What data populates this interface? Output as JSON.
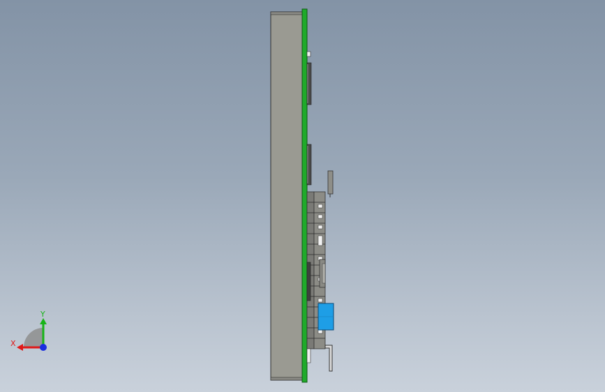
{
  "colors": {
    "background_top": "#8393a6",
    "background_bottom": "#c9d1db",
    "enclosure": "#9a9a92",
    "pcb": "#1faa2a",
    "component_dark": "#4a4a4a",
    "connector_blue": "#1e9ee6",
    "axis_x": "#e01818",
    "axis_y": "#18b418",
    "axis_z": "#1a2ee0"
  },
  "view": {
    "type": "3d-model-side-view",
    "orientation_triad": {
      "x_label": "X",
      "y_label": "Y"
    }
  }
}
